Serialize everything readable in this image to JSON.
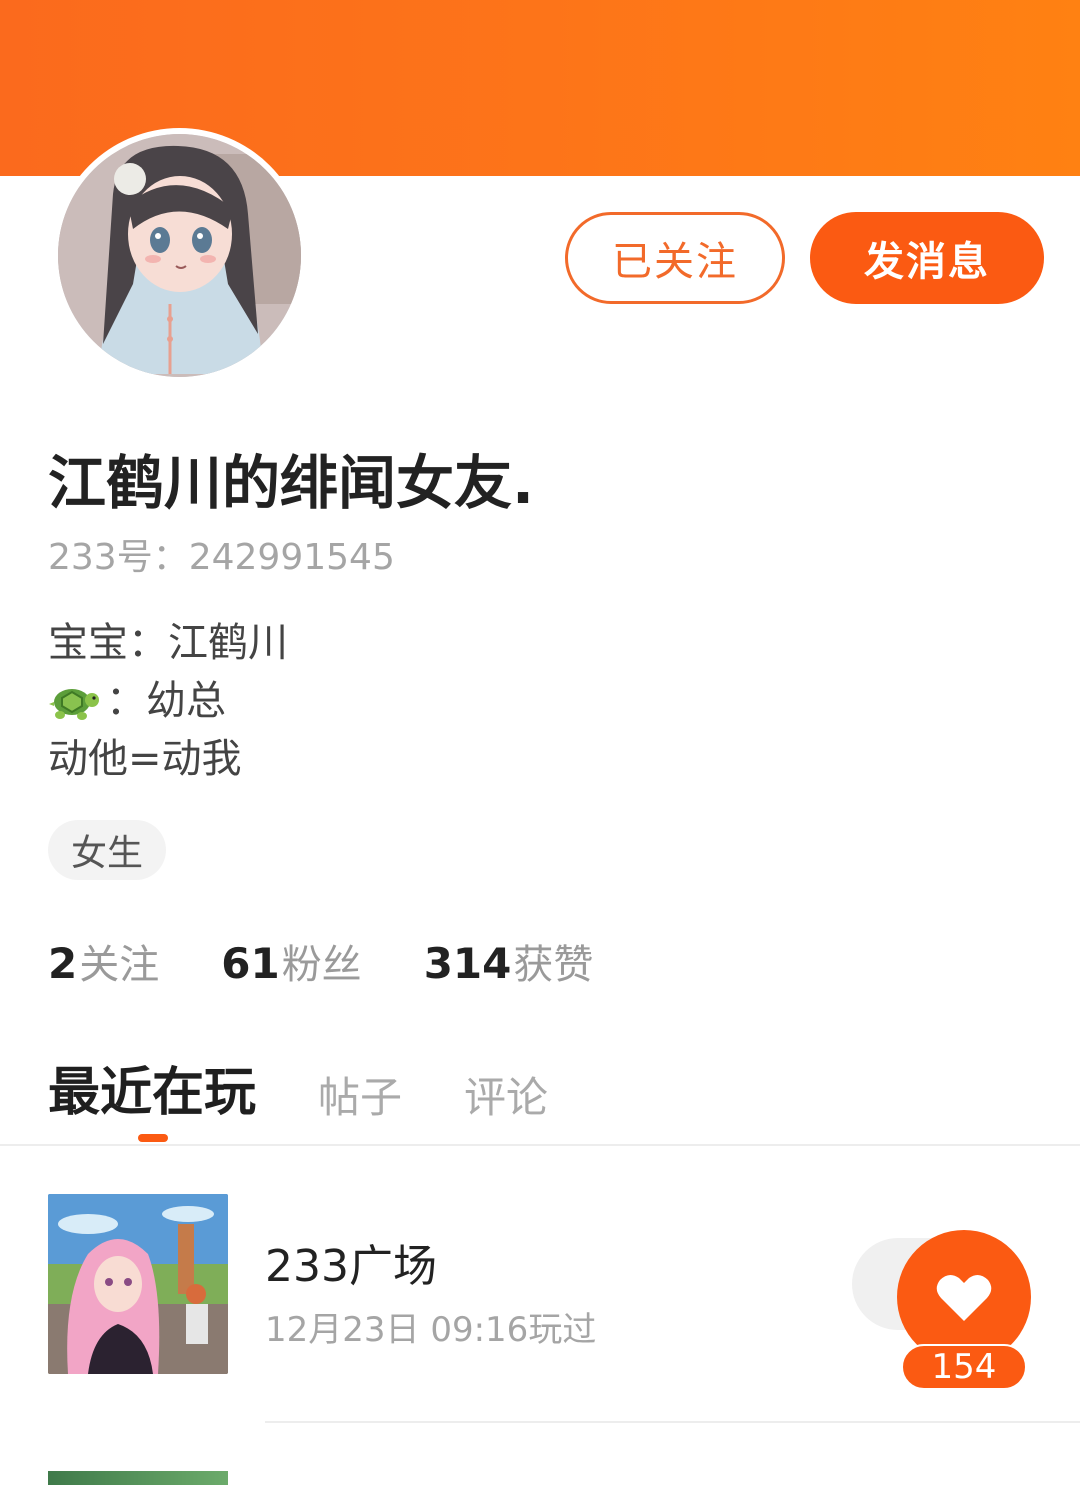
{
  "profile": {
    "username": "江鹤川的绯闻女友.",
    "id_label": "233号：",
    "id_value": "242991545",
    "bio": {
      "line1": "宝宝：江鹤川",
      "line2_suffix": "：幼总",
      "line2_emoji": "turtle-emoji",
      "line3": "动他=动我"
    },
    "gender_tag": "女生"
  },
  "actions": {
    "followed_label": "已关注",
    "message_label": "发消息"
  },
  "stats": [
    {
      "num": "2",
      "label": "关注"
    },
    {
      "num": "61",
      "label": "粉丝"
    },
    {
      "num": "314",
      "label": "获赞"
    }
  ],
  "tabs": [
    {
      "label": "最近在玩",
      "active": true
    },
    {
      "label": "帖子",
      "active": false
    },
    {
      "label": "评论",
      "active": false
    }
  ],
  "recent_games": [
    {
      "name": "233广场",
      "played_time": "12月23日 09:16玩过",
      "likes": "154"
    }
  ],
  "colors": {
    "accent": "#fb5a12",
    "header_gradient_start": "#fb6a1d",
    "header_gradient_end": "#ff8112"
  }
}
